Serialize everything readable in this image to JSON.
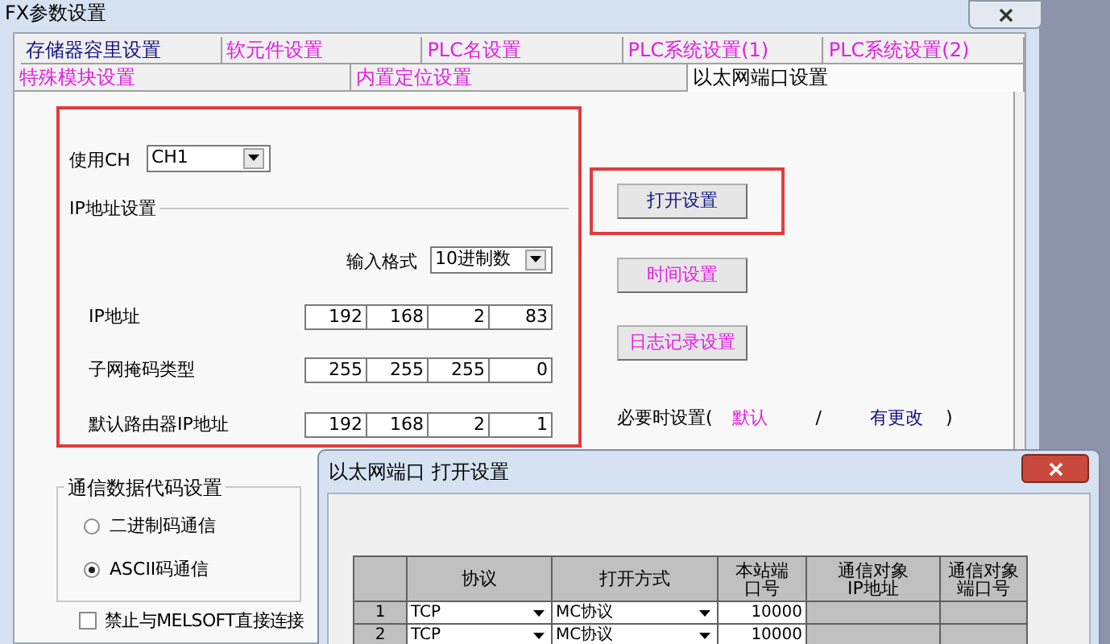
{
  "window": {
    "title": "FX参数设置"
  },
  "tab_rows": [
    {
      "tabs": [
        {
          "label": "存储器容里设置",
          "changed": true,
          "selected": false
        },
        {
          "label": "软元件设置",
          "changed": false,
          "selected": false
        },
        {
          "label": "PLC名设置",
          "changed": false,
          "selected": false
        },
        {
          "label": "PLC系统设置(1)",
          "changed": false,
          "selected": false
        },
        {
          "label": "PLC系统设置(2)",
          "changed": false,
          "selected": false
        }
      ]
    },
    {
      "tabs": [
        {
          "label": "特殊模块设置",
          "changed": false,
          "selected": false
        },
        {
          "label": "内置定位设置",
          "changed": false,
          "selected": false
        },
        {
          "label": "以太网端口设置",
          "selected": true
        }
      ]
    }
  ],
  "ip_section": {
    "highlighted": true,
    "channel_label": "使用CH",
    "channel_value": "CH1",
    "group_title": "IP地址设置",
    "format_label": "输入格式",
    "format_value": "10进制数",
    "rows": [
      {
        "label": "IP地址",
        "octets": [
          "192",
          "168",
          "2",
          "83"
        ]
      },
      {
        "label": "子网掩码类型",
        "octets": [
          "255",
          "255",
          "255",
          "0"
        ]
      },
      {
        "label": "默认路由器IP地址",
        "octets": [
          "192",
          "168",
          "2",
          "1"
        ]
      }
    ]
  },
  "buttons": [
    {
      "label": "打开设置",
      "changed": true,
      "highlighted": true
    },
    {
      "label": "时间设置",
      "changed": false,
      "highlighted": false
    },
    {
      "label": "日志记录设置",
      "changed": false,
      "highlighted": false
    }
  ],
  "legend": {
    "prefix": "必要时设置(",
    "default": "默认",
    "separator": "/",
    "changed": "有更改",
    "suffix": ")"
  },
  "code_group": {
    "title": "通信数据代码设置",
    "options": [
      {
        "label": "二进制码通信",
        "selected": false
      },
      {
        "label": "ASCII码通信",
        "selected": true
      }
    ]
  },
  "direct_connect": {
    "label": "禁止与MELSOFT直接连接",
    "checked": false
  },
  "dialog": {
    "title": "以太网端口 打开设置",
    "columns": [
      "协议",
      "打开方式",
      "本站端口号",
      "通信对象IP地址",
      "通信对象端口号"
    ],
    "rows": [
      {
        "number": "1",
        "protocol": "TCP",
        "open_method": "MC协议",
        "local_port": "10000"
      },
      {
        "number": "2",
        "protocol": "TCP",
        "open_method": "MC协议",
        "local_port": "10000"
      }
    ]
  }
}
